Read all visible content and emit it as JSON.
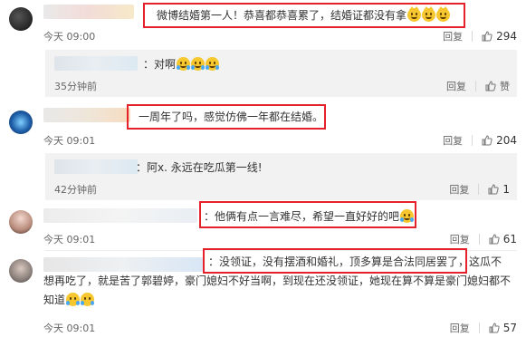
{
  "comments": [
    {
      "text": "微博结婚第一人！恭喜都恭喜累了，结婚证都没有拿",
      "time": "今天 09:00",
      "reply_label": "回复",
      "likes": "294",
      "reply": {
        "text": "：对啊",
        "time": "35分钟前",
        "reply_label": "回复",
        "like_label": "赞"
      }
    },
    {
      "text": "一周年了吗，感觉仿佛一年都在结婚。",
      "time": "今天 09:01",
      "reply_label": "回复",
      "likes": "204",
      "reply": {
        "text": "：阿x. 永远在吃瓜第一线!",
        "time": "42分钟前",
        "reply_label": "回复",
        "likes": "1"
      }
    },
    {
      "text": "：他俩有点一言难尽，希望一直好好的吧",
      "time": "今天 09:01",
      "reply_label": "回复",
      "likes": "61"
    },
    {
      "text_line1": "：没领证，没有摆酒和婚礼，顶多算是合法同居罢了，这瓜不",
      "text_line2": "想再吃了，就是苦了郭碧婷，豪门媳妇不好当啊，到现在还没领证，她现在算不算是豪门媳妇都不",
      "text_line3": "知道",
      "time": "今天 09:01",
      "reply_label": "回复",
      "likes": "57"
    }
  ],
  "colors": {
    "highlight": "#e5222a",
    "reply_bg": "#f2f2f2"
  },
  "icons": [
    "thumb-up-icon",
    "cat-laugh-emoji",
    "tears-of-joy-emoji",
    "cry-emoji"
  ]
}
